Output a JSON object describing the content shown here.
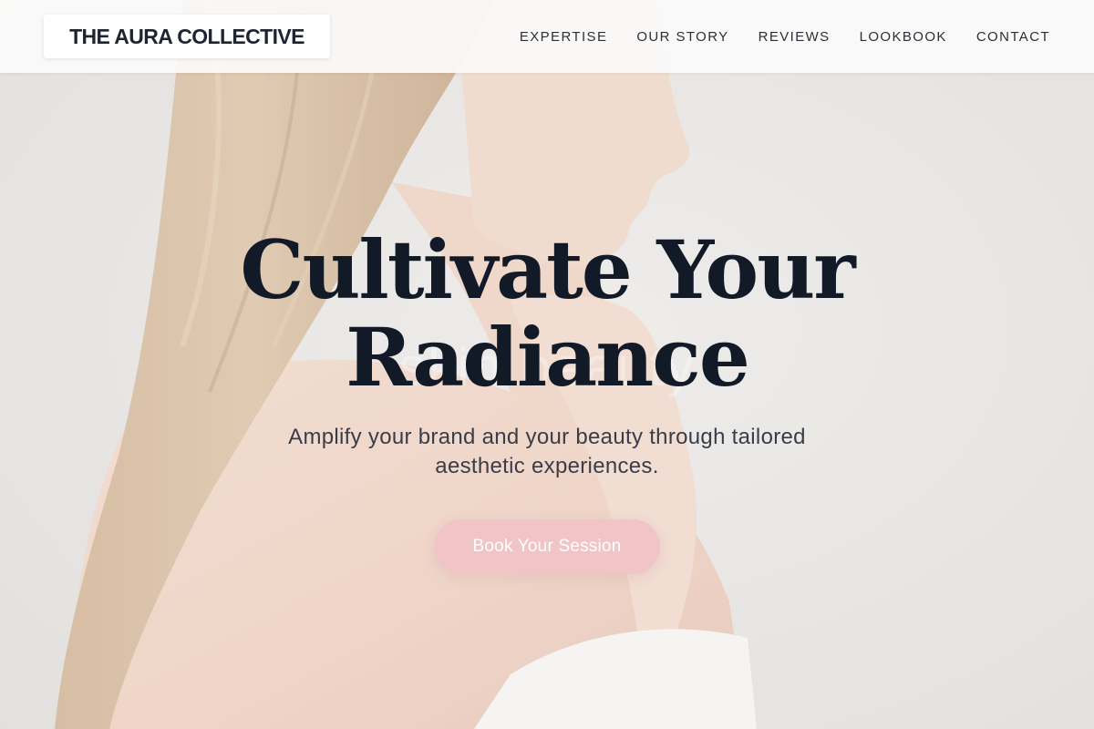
{
  "brand": {
    "name": "THE AURA COLLECTIVE"
  },
  "nav": {
    "items": [
      {
        "label": "EXPERTISE"
      },
      {
        "label": "OUR STORY"
      },
      {
        "label": "REVIEWS"
      },
      {
        "label": "LOOKBOOK"
      },
      {
        "label": "CONTACT"
      }
    ]
  },
  "hero": {
    "headline_line1": "Cultivate Your",
    "headline_line2": "Radiance",
    "subheadline": "Amplify your brand and your beauty through tailored aesthetic experiences.",
    "cta_label": "Book Your Session",
    "background_word": "skin beauty"
  },
  "colors": {
    "cta_background": "#f1c4c8",
    "headline": "#121a28",
    "header_background": "#fafafa"
  }
}
